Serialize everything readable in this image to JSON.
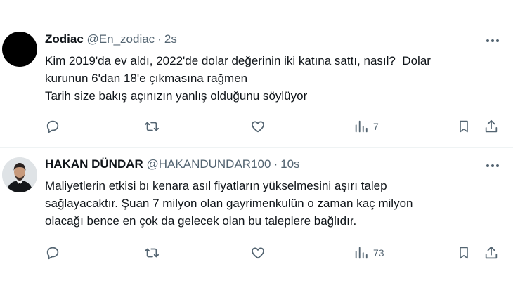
{
  "tweets": [
    {
      "author": "Zodiac",
      "handle": "@En_zodiac",
      "time": "2s",
      "lines": [
        "Kim 2019'da ev aldı, 2022'de dolar değerinin iki katına sattı, nasıl?  Dolar",
        "kurunun 6'dan 18'e çıkmasına rağmen",
        "Tarih size bakış açınızın yanlış olduğunu söylüyor"
      ],
      "views": "7"
    },
    {
      "author": "HAKAN DÜNDAR",
      "handle": "@HAKANDUNDAR100",
      "time": "10s",
      "lines": [
        "Maliyetlerin etkisi bı kenara asıl fiyatların yükselmesini aşırı talep",
        "sağlayacaktır. Şuan 7 milyon olan gayrimenkulün o zaman kaç milyon",
        "olacağı bence en çok da gelecek olan bu taleplere bağlıdır."
      ],
      "views": "73"
    }
  ],
  "colors": {
    "text": "#0f1419",
    "secondary": "#536471",
    "divider": "#eff3f4",
    "background": "#ffffff"
  },
  "icons": [
    "more-icon",
    "reply-icon",
    "retweet-icon",
    "like-icon",
    "views-icon",
    "bookmark-icon",
    "share-icon"
  ]
}
